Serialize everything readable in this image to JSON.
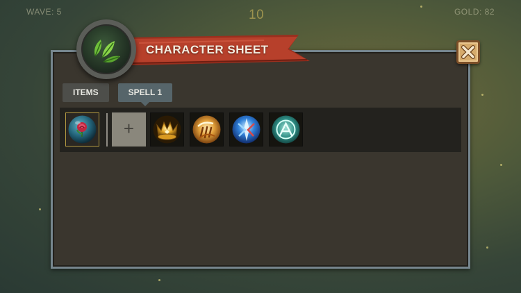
{
  "hud": {
    "wave": "WAVE: 5",
    "count": "10",
    "gold": "GOLD: 82"
  },
  "dialog": {
    "title": "CHARACTER SHEET",
    "emblem_icon": "leaves-icon",
    "close_icon": "close-icon",
    "tabs": [
      {
        "label": "ITEMS",
        "active": false
      },
      {
        "label": "SPELL 1",
        "active": true
      }
    ],
    "slots": {
      "item": {
        "icon": "rose-orb-icon"
      },
      "add_label": "+",
      "spells": [
        {
          "icon": "golden-crown-spell-icon"
        },
        {
          "icon": "golden-claw-spell-icon"
        },
        {
          "icon": "ice-blade-spell-icon"
        },
        {
          "icon": "teal-rune-spell-icon"
        }
      ]
    }
  },
  "colors": {
    "panel_bg": "#3a362e",
    "panel_border": "#76868e",
    "banner_red": "#b7402b",
    "close_bg": "#d6ab6c",
    "tab_active": "#56656a"
  }
}
